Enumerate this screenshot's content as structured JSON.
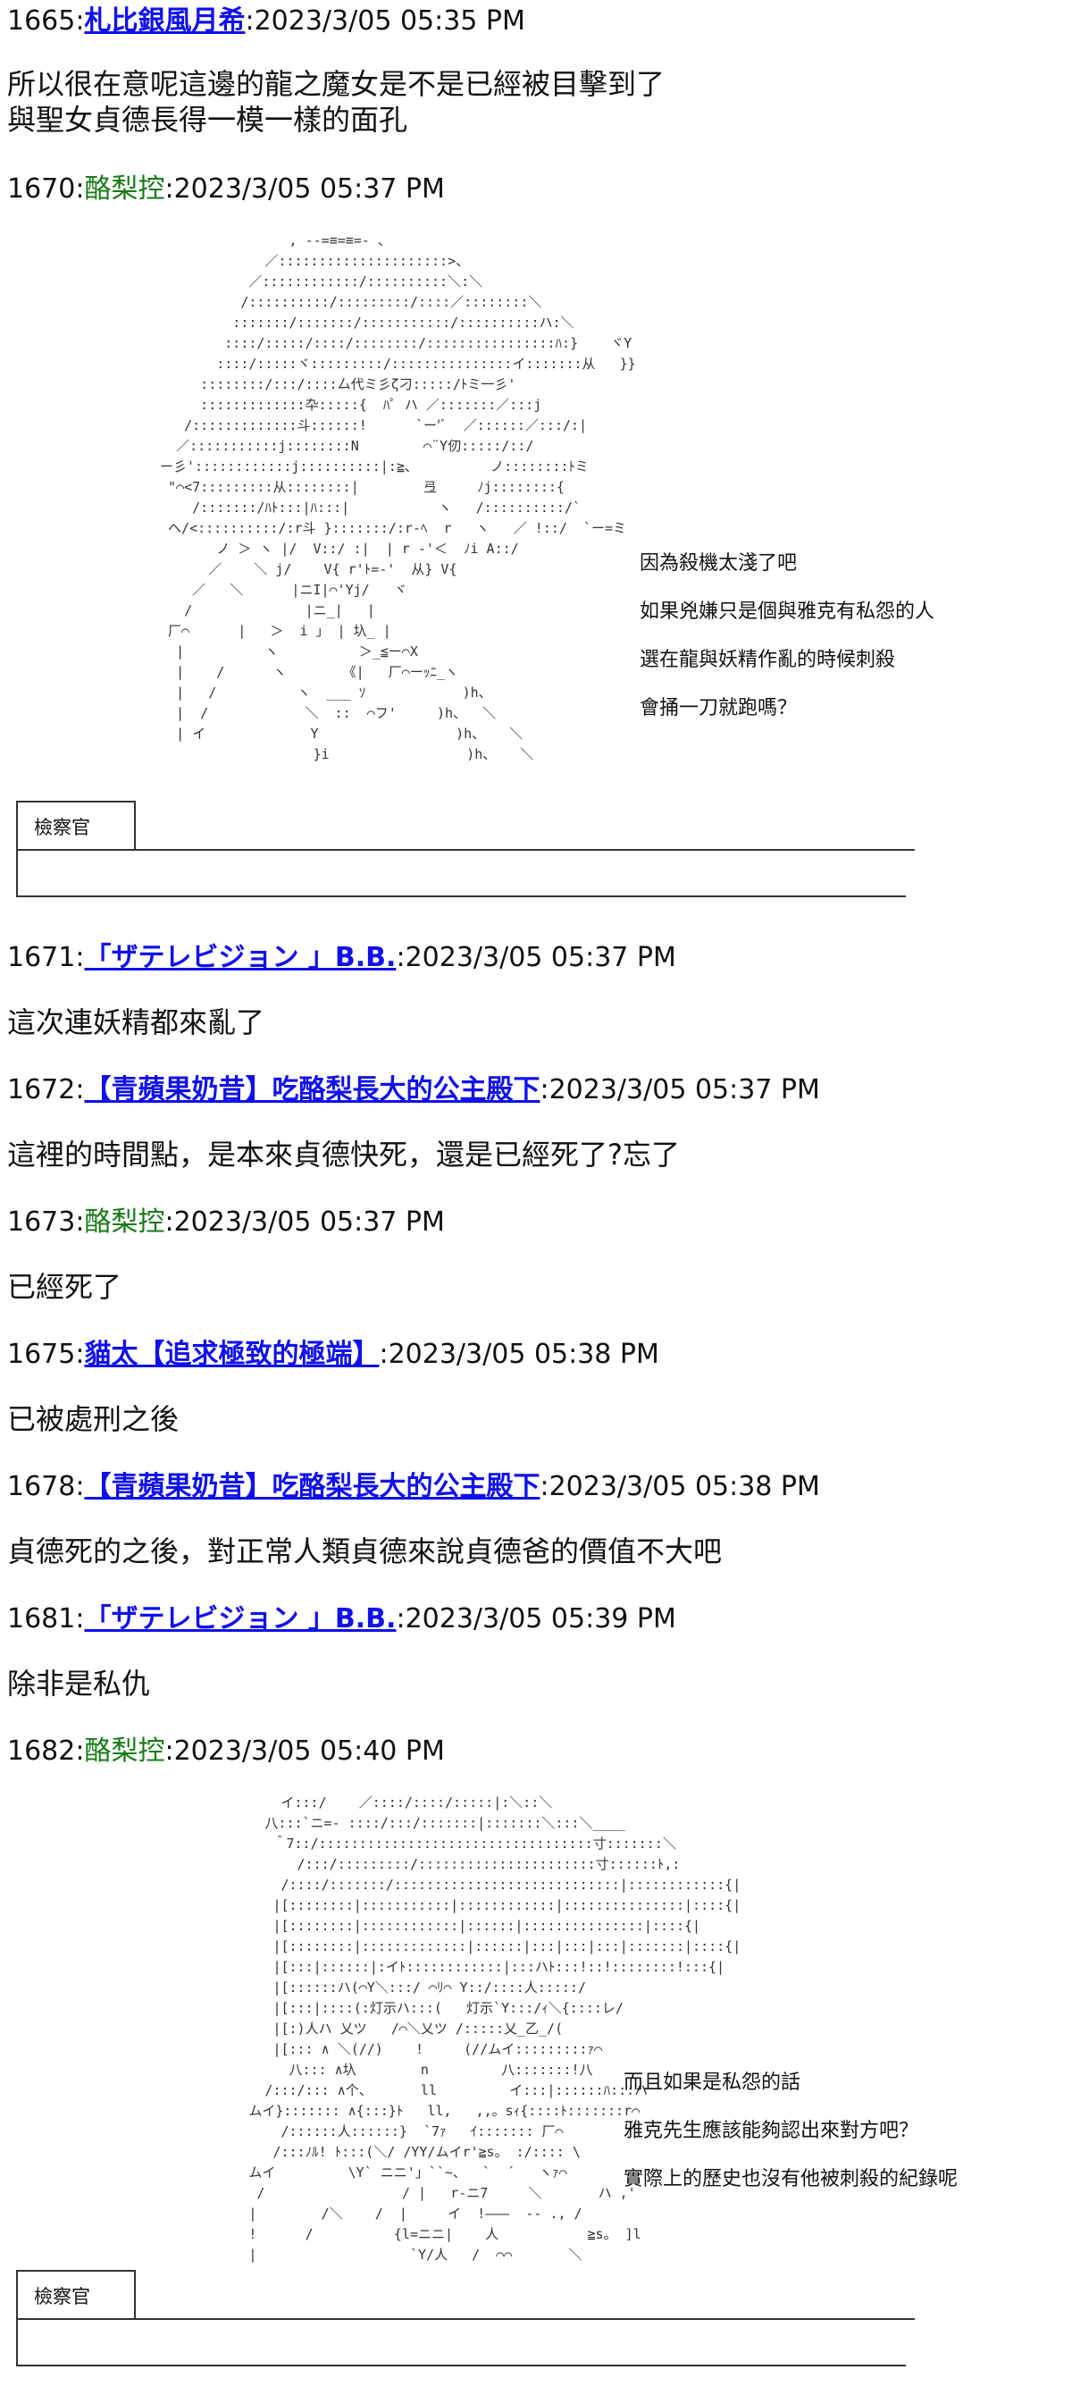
{
  "posts": [
    {
      "num": "1665",
      "name": "札比銀風月希",
      "date": "2023/3/05 05:35 PM",
      "lines": [
        "所以很在意呢這邊的龍之魔女是不是已經被目擊到了",
        "與聖女貞德長得一模一樣的面孔"
      ]
    },
    {
      "num": "1670",
      "name": "酪梨控",
      "date": "2023/3/05 05:37 PM",
      "speech": [
        "因為殺機太淺了吧",
        "如果兇嫌只是個與雅克有私怨的人",
        "選在龍與妖精作亂的時候刺殺",
        "會捅一刀就跑嗎？"
      ],
      "box_label": "檢察官"
    },
    {
      "num": "1671",
      "name": "「ザテレビジョン 」B.B.",
      "date": "2023/3/05 05:37 PM",
      "lines": [
        "這次連妖精都來亂了"
      ]
    },
    {
      "num": "1672",
      "name": "【青蘋果奶昔】吃酪梨長大的公主殿下",
      "date": "2023/3/05 05:37 PM",
      "lines": [
        "這裡的時間點，是本來貞德快死，還是已經死了?忘了"
      ]
    },
    {
      "num": "1673",
      "name": "酪梨控",
      "date": "2023/3/05 05:37 PM",
      "lines": [
        "已經死了"
      ]
    },
    {
      "num": "1675",
      "name": "貓太【追求極致的極端】",
      "date": "2023/3/05 05:38 PM",
      "lines": [
        "已被處刑之後"
      ]
    },
    {
      "num": "1678",
      "name": "【青蘋果奶昔】吃酪梨長大的公主殿下",
      "date": "2023/3/05 05:38 PM",
      "lines": [
        "貞德死的之後，對正常人類貞德來說貞德爸的價值不大吧"
      ]
    },
    {
      "num": "1681",
      "name": "「ザテレビジョン 」B.B.",
      "date": "2023/3/05 05:39 PM",
      "lines": [
        "除非是私仇"
      ]
    },
    {
      "num": "1682",
      "name": "酪梨控",
      "date": "2023/3/05 05:40 PM",
      "speech": [
        "而且如果是私怨的話",
        "雅克先生應該能夠認出來對方吧？",
        "實際上的歷史也沒有他被刺殺的紀錄呢"
      ],
      "box_label": "檢察官"
    }
  ],
  "ascii_art": {
    "a1": "                 , --=≡=≡=- 、\n              ／:::::::::::::::::::::>、\n            ／::::::::::::/::::::::::＼:＼\n           /::::::::::/:::::::::/::::／::::::::＼\n          :::::::/:::::::/:::::::::::/::::::::::ハ:＼\n         ::::/:::::/::::/::::::::/::::::::::::::::ﾊ:}    ヾY\n        ::::/:::::ヾ:::::::::/:::::::::::::::イ:::::::从   }}\n      ::::::::/:::/::::厶代ミ彡ζ刁:::::/ﾄミ一彡'\n      :::::::::::::卆:::::{  ﾊﾟ ハ ／:::::::／:::j\n    /:::::::::::::斗::::::!      `ー'ﾞ  ／::::::／:::/:|\n   ／:::::::::::j::::::::N        ⌒¨Y仞:::::/::/\n ー彡'::::::::::::j::::::::::|:≧、         ノ::::::::ﾄミ\n  \"⌒<7:::::::::从::::::::|        弖     ﾉj::::::::{\n     /:::::::/ﾊﾄ:::|ﾊ:::|           ヽ   /::::::::::/`\n  ヘ/<::::::::::/:r斗 }:::::::/:r-ﾍ  r   ヽ   ／ !::/  `ー=ミ\n        ノ ＞ ヽ |/  V::/ :|  | r -'＜  ﾉi A::/\n       ／    ＼ j/    V{ r'ﾄ=-'  从} V{\n     ／   ＼      |ニI|⌒'Yj/   ヾ\n    /              |ニ_|   |\n  厂⌒      |   ＞  i 」 | 圦_ |\n   |          ヽ          ＞_≦ー⌒X\n   |    /      ヽ       《|   厂⌒ーｯﾆ_ヽ\n   |   /          ヽ  ___ ｿ            )h、\n   |  /            ＼  ::  ⌒フ'     )h、  ＼\n   | イ             Y                 )h、   ＼\n                    }i                 )h、   ＼",
    "a2": "                イ:::/    ／::::/::::/:::::|:＼::＼\n              八:::`ニ=- ::::/:::/:::::::|:::::::＼:::＼____\n               ＾7::/::::::::::::::::::::::::::::::::::寸:::::::＼\n                  /:::/:::::::::/::::::::::::::::::::::寸::::::ﾄ,:\n                /::::/:::::::/::::::::::::::::::::::::::::|::::::::::::{|\n               |[::::::::|:::::::::::|::::::::::::|:::::::::::::::|::::{|\n               |[::::::::|::::::::::::|::::::|:::::::::::::::|::::{|\n               |[::::::::|:::::::::::::|::::::|:::|:::|:::|:::::::|::::{|\n               |[:::|::::::|:イﾄ::::::::::::|:::ハﾄ:::!::!::::::::!:::{|\n               |[::::::ハ(⌒Y＼:::/ ⌒ﾘ⌒ Y::/::::人:::::/\n               |[:::|::::(:灯示ハ:::(   灯示`Y:::/ｨ＼{::::レ/\n               |[:)人ハ 乂ツ   /⌒＼乂ツ /:::::乂_乙_/(\n               |[::: ∧ ＼(//)    !     (//ムイ:::::::::ｧ⌒\n                 八::: ∧圦        n         八:::::::!八\n              /:::/::: ∧个、      ll         イ:::|::::::ﾊ:::ハ\n            ムイ}::::::: ∧{:::}ﾄ   ll,   ,,。sｨ{::::ﾄ:::::::r⌒\n                /::::::人::::::}  `7ｧ   ｲ::::::: 厂⌒\n               /:::ﾉﾙ! ﾄ:::(＼/ /YY/ムイr'≧s。 :/:::: \\\n            ムイ         \\Y` ニニ'」``~、  `  ´   ヽｧ⌒\n             /                 / |   r-ニ7     ＼       ハ ,'\n            |        /＼    /  |     イ  !———  -- ., /\n            !      /          {l=ニニ|    人           ≧s。 ]l\n            |                   `Y/人   /  ⌒⌒       ＼"
  }
}
